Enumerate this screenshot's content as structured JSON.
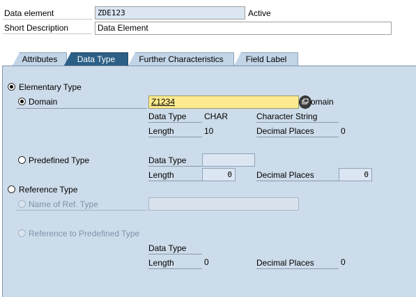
{
  "header": {
    "data_element_label": "Data element",
    "data_element_value": "ZDE123",
    "status": "Active",
    "short_desc_label": "Short Description",
    "short_desc_value": "Data Element"
  },
  "tabs": [
    {
      "label": "Attributes",
      "active": false
    },
    {
      "label": "Data Type",
      "active": true
    },
    {
      "label": "Further Characteristics",
      "active": false
    },
    {
      "label": "Field Label",
      "active": false
    }
  ],
  "elementary": {
    "label": "Elementary Type",
    "selected": true,
    "domain": {
      "label": "Domain",
      "selected": true,
      "value": "Z1234",
      "button_suffix": "omain",
      "data_type_label": "Data Type",
      "data_type_value": "CHAR",
      "data_type_desc": "Character String",
      "length_label": "Length",
      "length_value": "10",
      "decimal_label": "Decimal Places",
      "decimal_value": "0"
    },
    "predefined": {
      "label": "Predefined Type",
      "selected": false,
      "data_type_label": "Data Type",
      "data_type_value": "",
      "length_label": "Length",
      "length_value": "0",
      "decimal_label": "Decimal Places",
      "decimal_value": "0"
    }
  },
  "reference": {
    "label": "Reference Type",
    "selected": false,
    "name_ref_label": "Name of Ref. Type",
    "name_ref_value": "",
    "ref_predef_label": "Reference to Predefined Type",
    "data_type_label": "Data Type",
    "length_label": "Length",
    "length_value": "0",
    "decimal_label": "Decimal Places",
    "decimal_value": "0"
  },
  "colors": {
    "panel_bg": "#cddcea",
    "active_tab": "#2c5f86",
    "domain_field": "#fdeb8f"
  }
}
